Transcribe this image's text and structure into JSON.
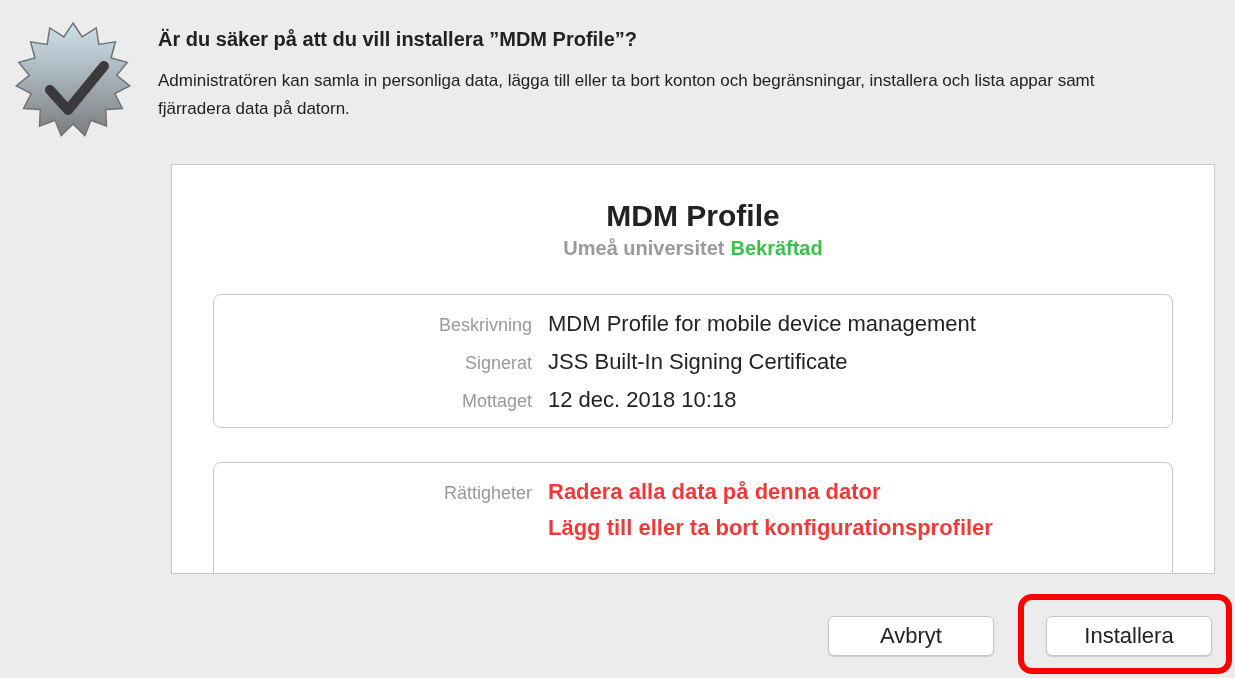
{
  "dialog": {
    "title": "Är du säker på att du vill installera ”MDM Profile”?",
    "message": "Administratören kan samla in personliga data, lägga till eller ta bort konton och begränsningar, installera och lista appar samt fjärradera data på datorn."
  },
  "profile": {
    "name": "MDM Profile",
    "issuer": "Umeå universitet",
    "verification": "Bekräftad",
    "details": [
      {
        "label": "Beskrivning",
        "value": "MDM Profile for mobile device management"
      },
      {
        "label": "Signerat",
        "value": "JSS Built-In Signing Certificate"
      },
      {
        "label": "Mottaget",
        "value": "12 dec. 2018 10:18"
      }
    ],
    "permissions": {
      "label": "Rättigheter",
      "items": [
        "Radera alla data på denna dator",
        "Lägg till eller ta bort konfigurationsprofiler"
      ]
    }
  },
  "buttons": [
    {
      "label": "Avbryt",
      "highlighted": false
    },
    {
      "label": "Installera",
      "highlighted": true
    }
  ]
}
